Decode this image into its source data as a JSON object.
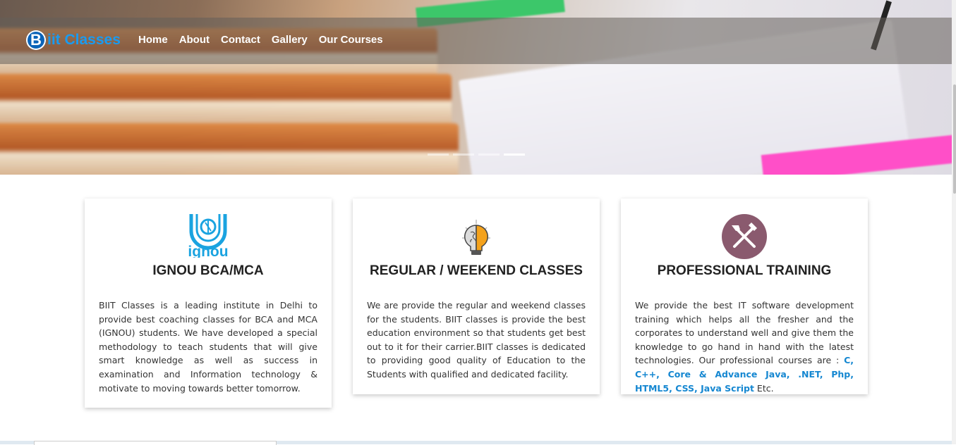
{
  "brand": {
    "logo_letter": "B",
    "name": "iit Classes",
    "accent": "#1a9bf0"
  },
  "nav": {
    "items": [
      "Home",
      "About",
      "Contact",
      "Gallery",
      "Our Courses"
    ]
  },
  "carousel": {
    "slides_total": 4,
    "active_slide": 4
  },
  "cards": [
    {
      "icon": "ignou-logo-icon",
      "icon_text": "ignou",
      "title": "IGNOU BCA/MCA",
      "text": "BIIT Classes is a leading institute in Delhi to provide best coaching classes for BCA and MCA (IGNOU) students. We have developed a special methodology to teach students that will give smart knowledge as well as success in examination and Information technology & motivate to moving towards better tomorrow."
    },
    {
      "icon": "brain-bulb-icon",
      "title": "REGULAR / WEEKEND CLASSES",
      "text": "We are provide the regular and weekend classes for the students. BIIT classes is provide the best education environment so that students get best out to it for their carrier.BIIT classes is dedicated to providing good quality of Education to the Students with qualified and dedicated facility."
    },
    {
      "icon": "tools-icon",
      "title": "PROFESSIONAL TRAINING",
      "text_before": "We provide the best IT software development training which helps all the fresher and the corporates to understand well and give them the knowledge to go hand in hand with the latest technologies. Our professional courses are : ",
      "highlight": "C, C++, Core & Advance Java, .NET, Php, HTML5, CSS, Java Script",
      "text_after": " Etc."
    }
  ],
  "colors": {
    "highlight": "#1587d1",
    "tools_circle": "#8a5a6e",
    "ignou_blue": "#1aa3e0"
  }
}
